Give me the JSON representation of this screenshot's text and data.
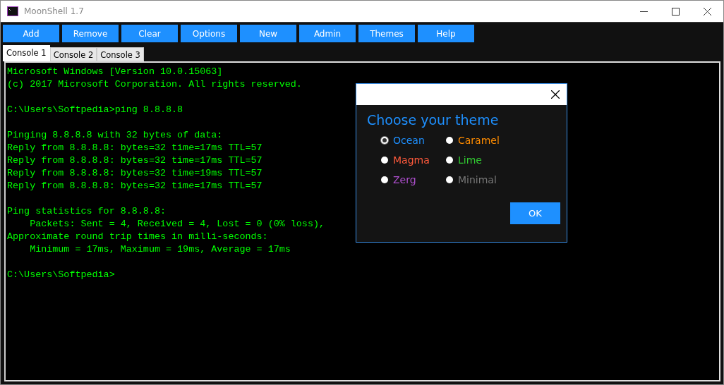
{
  "window": {
    "title": "MoonShell 1.7"
  },
  "toolbar": [
    "Add",
    "Remove",
    "Clear",
    "Options",
    "New",
    "Admin",
    "Themes",
    "Help"
  ],
  "tabs": [
    {
      "label": "Console 1",
      "selected": true
    },
    {
      "label": "Console 2",
      "selected": false
    },
    {
      "label": "Console 3",
      "selected": false
    }
  ],
  "console": {
    "blocks": [
      [
        "Microsoft Windows [Version 10.0.15063]",
        "(c) 2017 Microsoft Corporation. All rights reserved."
      ],
      [
        "C:\\Users\\Softpedia>ping 8.8.8.8"
      ],
      [
        "Pinging 8.8.8.8 with 32 bytes of data:",
        "Reply from 8.8.8.8: bytes=32 time=17ms TTL=57",
        "Reply from 8.8.8.8: bytes=32 time=17ms TTL=57",
        "Reply from 8.8.8.8: bytes=32 time=19ms TTL=57",
        "Reply from 8.8.8.8: bytes=32 time=17ms TTL=57"
      ],
      [
        "Ping statistics for 8.8.8.8:",
        "    Packets: Sent = 4, Received = 4, Lost = 0 (0% loss),",
        "Approximate round trip times in milli-seconds:",
        "    Minimum = 17ms, Maximum = 19ms, Average = 17ms"
      ],
      [
        "C:\\Users\\Softpedia>"
      ]
    ]
  },
  "dialog": {
    "heading": "Choose your theme",
    "options": [
      {
        "label": "Ocean",
        "color": "#1e90ff",
        "selected": true
      },
      {
        "label": "Caramel",
        "color": "#ff8c00",
        "selected": false
      },
      {
        "label": "Magma",
        "color": "#ff5a3c",
        "selected": false
      },
      {
        "label": "Lime",
        "color": "#32cd32",
        "selected": false
      },
      {
        "label": "Zerg",
        "color": "#b050d0",
        "selected": false
      },
      {
        "label": "Minimal",
        "color": "#777777",
        "selected": false
      }
    ],
    "ok": "OK"
  }
}
